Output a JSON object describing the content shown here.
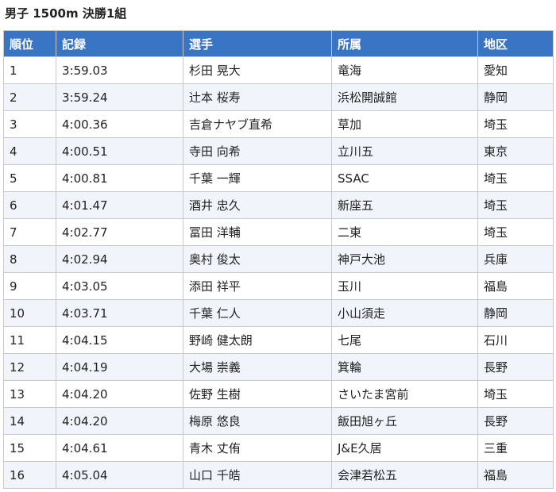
{
  "title": "男子 1500m 決勝1組",
  "columns": [
    "順位",
    "記録",
    "選手",
    "所属",
    "地区"
  ],
  "rows": [
    {
      "rank": "1",
      "time": "3:59.03",
      "athlete": "杉田 晃大",
      "team": "竜海",
      "region": "愛知"
    },
    {
      "rank": "2",
      "time": "3:59.24",
      "athlete": "辻本 桜寿",
      "team": "浜松開誠館",
      "region": "静岡"
    },
    {
      "rank": "3",
      "time": "4:00.36",
      "athlete": "吉倉ナヤブ直希",
      "team": "草加",
      "region": "埼玉"
    },
    {
      "rank": "4",
      "time": "4:00.51",
      "athlete": "寺田 向希",
      "team": "立川五",
      "region": "東京"
    },
    {
      "rank": "5",
      "time": "4:00.81",
      "athlete": "千葉 一輝",
      "team": "SSAC",
      "region": "埼玉"
    },
    {
      "rank": "6",
      "time": "4:01.47",
      "athlete": "酒井 忠久",
      "team": "新座五",
      "region": "埼玉"
    },
    {
      "rank": "7",
      "time": "4:02.77",
      "athlete": "冨田 洋輔",
      "team": "二東",
      "region": "埼玉"
    },
    {
      "rank": "8",
      "time": "4:02.94",
      "athlete": "奥村 俊太",
      "team": "神戸大池",
      "region": "兵庫"
    },
    {
      "rank": "9",
      "time": "4:03.05",
      "athlete": "添田 祥平",
      "team": "玉川",
      "region": "福島"
    },
    {
      "rank": "10",
      "time": "4:03.71",
      "athlete": "千葉 仁人",
      "team": "小山須走",
      "region": "静岡"
    },
    {
      "rank": "11",
      "time": "4:04.15",
      "athlete": "野崎 健太朗",
      "team": "七尾",
      "region": "石川"
    },
    {
      "rank": "12",
      "time": "4:04.19",
      "athlete": "大場 崇義",
      "team": "箕輪",
      "region": "長野"
    },
    {
      "rank": "13",
      "time": "4:04.20",
      "athlete": "佐野 生樹",
      "team": "さいたま宮前",
      "region": "埼玉"
    },
    {
      "rank": "14",
      "time": "4:04.20",
      "athlete": "梅原 悠良",
      "team": "飯田旭ヶ丘",
      "region": "長野"
    },
    {
      "rank": "15",
      "time": "4:04.61",
      "athlete": "青木 丈侑",
      "team": "J&E久居",
      "region": "三重"
    },
    {
      "rank": "16",
      "time": "4:05.04",
      "athlete": "山口 千皓",
      "team": "会津若松五",
      "region": "福島"
    }
  ],
  "colors": {
    "header_bg": "#3a74c4",
    "header_text": "#ffffff",
    "row_alt_bg": "#f1f4fa",
    "border": "#c9c9c9"
  }
}
